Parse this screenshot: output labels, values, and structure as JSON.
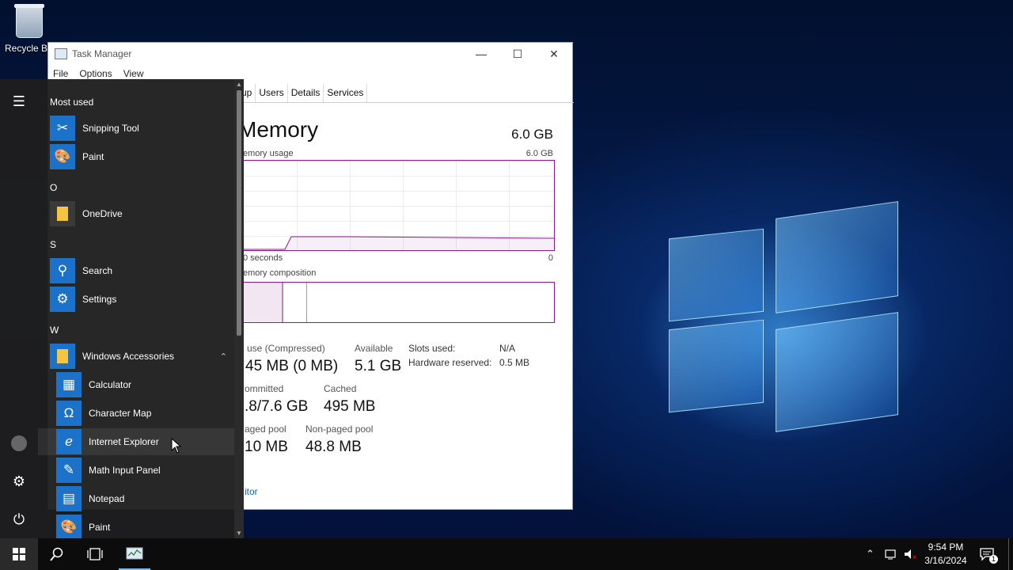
{
  "desktop": {
    "recycle_bin_label": "Recycle Bin"
  },
  "task_manager": {
    "title": "Task Manager",
    "menu": [
      "File",
      "Options",
      "View"
    ],
    "tabs": [
      "up",
      "Users",
      "Details",
      "Services"
    ],
    "memory_title": "Memory",
    "total": "6.0 GB",
    "usage_label": "emory usage",
    "usage_max": "6.0 GB",
    "seconds_label": "0 seconds",
    "zero": "0",
    "composition_label": "emory composition",
    "stats": {
      "in_use_label": "use (Compressed)",
      "in_use_value": "45 MB (0 MB)",
      "available_label": "Available",
      "available_value": "5.1 GB",
      "committed_label": "ommitted",
      "committed_value": ".8/7.6 GB",
      "cached_label": "Cached",
      "cached_value": "495 MB",
      "paged_label": "aged pool",
      "paged_value": "10 MB",
      "nonpaged_label": "Non-paged pool",
      "nonpaged_value": "48.8 MB"
    },
    "slots_label": "Slots used:",
    "slots_value": "N/A",
    "hw_reserved_label": "Hardware reserved:",
    "hw_reserved_value": "0.5 MB",
    "monitor_link": "itor"
  },
  "start_menu": {
    "most_used": "Most used",
    "apps_top": [
      {
        "name": "Snipping Tool",
        "icon": "scissors-icon"
      },
      {
        "name": "Paint",
        "icon": "palette-icon"
      }
    ],
    "letter_o": "O",
    "onedrive": "OneDrive",
    "letter_s": "S",
    "search": "Search",
    "settings": "Settings",
    "letter_w": "W",
    "accessories_folder": "Windows Accessories",
    "accessories": [
      {
        "name": "Calculator",
        "icon": "calculator-icon"
      },
      {
        "name": "Character Map",
        "icon": "character-map-icon"
      },
      {
        "name": "Internet Explorer",
        "icon": "ie-icon"
      },
      {
        "name": "Math Input Panel",
        "icon": "math-input-icon"
      },
      {
        "name": "Notepad",
        "icon": "notepad-icon"
      },
      {
        "name": "Paint",
        "icon": "palette-icon"
      }
    ]
  },
  "taskbar": {
    "time": "9:54 PM",
    "date": "3/16/2024",
    "notification_count": "1"
  },
  "colors": {
    "accent": "#1c72c9",
    "graph_border": "#8b1a8b"
  }
}
